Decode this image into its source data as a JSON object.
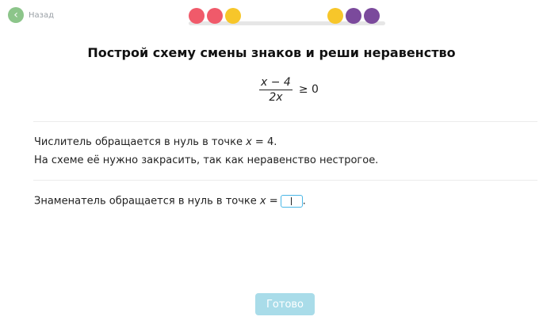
{
  "nav": {
    "back_label": "Назад"
  },
  "progress": {
    "dots": [
      "#f05a6a",
      "#f05a6a",
      "#f7c62a",
      "#f7c62a",
      "#7b4a9c",
      "#7b4a9c"
    ]
  },
  "task": {
    "title": "Построй схему смены знаков и реши неравенство",
    "numerator": "x − 4",
    "denominator": "2x",
    "inequality": "≥ 0"
  },
  "step1": {
    "line1_prefix": "Числитель обращается в нуль в точке ",
    "line1_var": "x",
    "line1_suffix": " = 4.",
    "line2": "На схеме её нужно закрасить, так как неравенство нестрогое."
  },
  "step2": {
    "prefix": "Знаменатель обращается в нуль в точке ",
    "var": "x",
    "eq": " =",
    "end": "."
  },
  "footer": {
    "done_label": "Готово"
  }
}
